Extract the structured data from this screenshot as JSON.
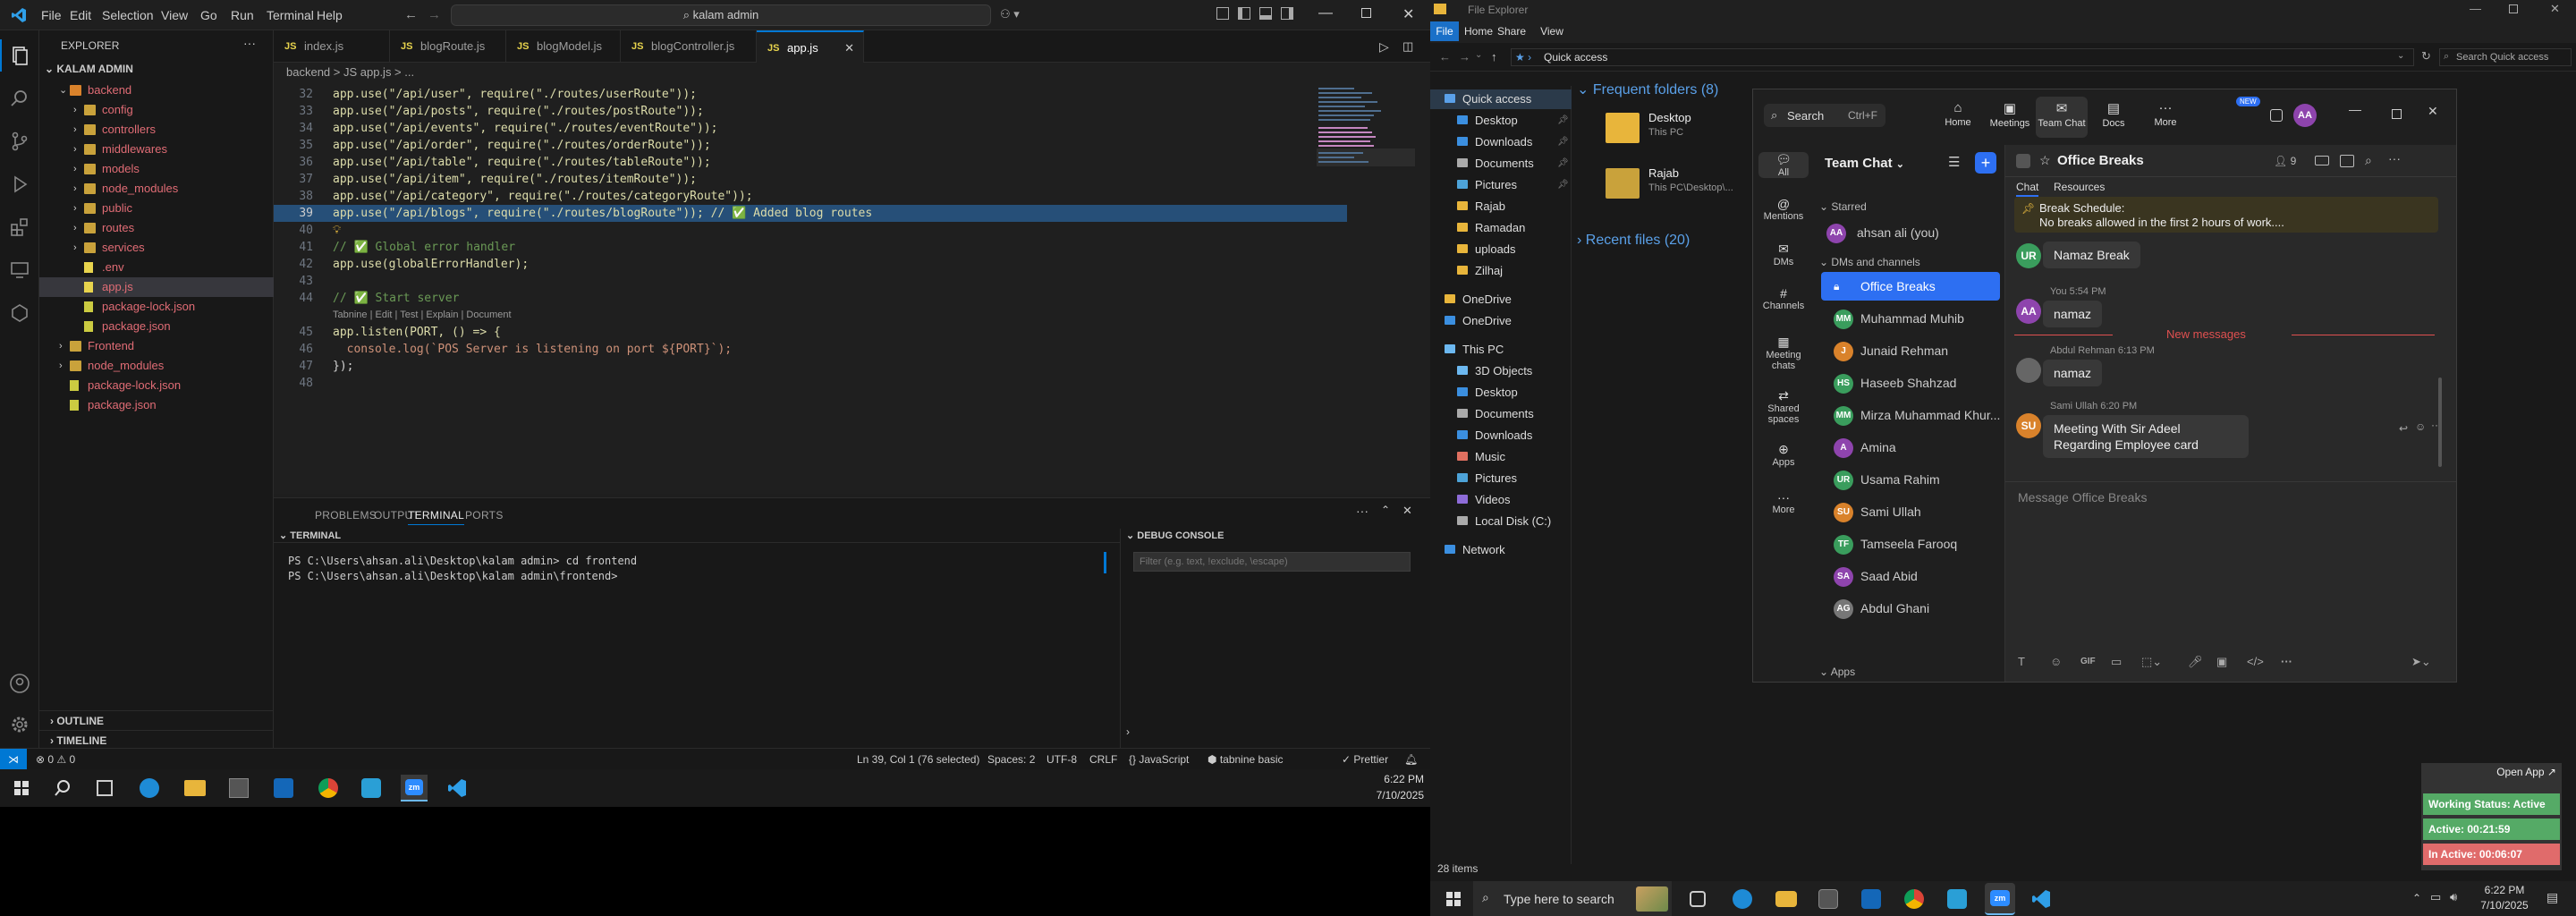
{
  "vscode": {
    "menu": [
      "File",
      "Edit",
      "Selection",
      "View",
      "Go",
      "Run",
      "Terminal",
      "Help"
    ],
    "search_text": "kalam admin",
    "explorer_title": "EXPLORER",
    "root": "KALAM ADMIN",
    "tree": [
      {
        "label": "backend",
        "type": "folder-open",
        "color": "#e06c75"
      },
      {
        "label": "config",
        "type": "folder",
        "color": "#e06c75"
      },
      {
        "label": "controllers",
        "type": "folder",
        "color": "#e06c75"
      },
      {
        "label": "middlewares",
        "type": "folder",
        "color": "#e06c75"
      },
      {
        "label": "models",
        "type": "folder",
        "color": "#e06c75"
      },
      {
        "label": "node_modules",
        "type": "folder",
        "color": "#e06c75"
      },
      {
        "label": "public",
        "type": "folder",
        "color": "#e06c75"
      },
      {
        "label": "routes",
        "type": "folder",
        "color": "#e06c75"
      },
      {
        "label": "services",
        "type": "folder",
        "color": "#e06c75"
      },
      {
        "label": ".env",
        "type": "file",
        "color": "#e06c75"
      },
      {
        "label": "app.js",
        "type": "file",
        "color": "#e06c75"
      },
      {
        "label": "package-lock.json",
        "type": "file",
        "color": "#e06c75"
      },
      {
        "label": "package.json",
        "type": "file",
        "color": "#e06c75"
      },
      {
        "label": "Frontend",
        "type": "folder",
        "color": "#e06c75"
      },
      {
        "label": "node_modules",
        "type": "folder",
        "color": "#e06c75"
      },
      {
        "label": "package-lock.json",
        "type": "file",
        "color": "#e06c75"
      },
      {
        "label": "package.json",
        "type": "file",
        "color": "#e06c75"
      }
    ],
    "outline": "OUTLINE",
    "timeline": "TIMELINE",
    "tabs": [
      "index.js",
      "blogRoute.js",
      "blogModel.js",
      "blogController.js",
      "app.js"
    ],
    "breadcrumb": "backend > JS app.js > ...",
    "code": [
      {
        "n": "32",
        "t": "app.use(\"/api/user\", require(\"./routes/userRoute\"));"
      },
      {
        "n": "33",
        "t": "app.use(\"/api/posts\", require(\"./routes/postRoute\"));"
      },
      {
        "n": "34",
        "t": "app.use(\"/api/events\", require(\"./routes/eventRoute\"));"
      },
      {
        "n": "35",
        "t": "app.use(\"/api/order\", require(\"./routes/orderRoute\"));"
      },
      {
        "n": "36",
        "t": "app.use(\"/api/table\", require(\"./routes/tableRoute\"));"
      },
      {
        "n": "37",
        "t": "app.use(\"/api/item\", require(\"./routes/itemRoute\"));"
      },
      {
        "n": "38",
        "t": "app.use(\"/api/category\", require(\"./routes/categoryRoute\"));"
      },
      {
        "n": "39",
        "t": "app.use(\"/api/blogs\", require(\"./routes/blogRoute\")); // ✅ Added blog routes"
      },
      {
        "n": "40",
        "t": ""
      },
      {
        "n": "41",
        "t": "// ✅ Global error handler"
      },
      {
        "n": "42",
        "t": "app.use(globalErrorHandler);"
      },
      {
        "n": "43",
        "t": ""
      },
      {
        "n": "44",
        "t": "// ✅ Start server"
      },
      {
        "n": "",
        "t": "Tabnine | Edit | Test | Explain | Document"
      },
      {
        "n": "45",
        "t": "app.listen(PORT, () => {"
      },
      {
        "n": "46",
        "t": "  console.log(`POS Server is listening on port ${PORT}`);"
      },
      {
        "n": "47",
        "t": "});"
      },
      {
        "n": "48",
        "t": ""
      }
    ],
    "panel_tabs": [
      "PROBLEMS",
      "OUTPUT",
      "TERMINAL",
      "PORTS"
    ],
    "terminal_title": "TERMINAL",
    "terminal_lines": [
      "PS C:\\Users\\ahsan.ali\\Desktop\\kalam admin> cd frontend",
      "PS C:\\Users\\ahsan.ali\\Desktop\\kalam admin\\frontend> "
    ],
    "debug_title": "DEBUG CONSOLE",
    "debug_filter": "Filter (e.g. text, !exclude, \\escape)",
    "status": {
      "errors": "⊗ 0 ⚠ 0",
      "position": "Ln 39, Col 1 (76 selected)",
      "spaces": "Spaces: 2",
      "encoding": "UTF-8",
      "eol": "CRLF",
      "language": "{} JavaScript",
      "tabnine": "tabnine basic",
      "prettier": "✓ Prettier"
    },
    "taskbar_time": "6:22 PM",
    "taskbar_date": "7/10/2025"
  },
  "explorer": {
    "title": "File Explorer",
    "ribbon_tabs": [
      "File",
      "Home",
      "Share",
      "View"
    ],
    "address": "Quick access",
    "search": "Search Quick access",
    "nav": [
      {
        "label": "Quick access",
        "indent": 0,
        "icon": "star-icon"
      },
      {
        "label": "Desktop",
        "indent": 1,
        "icon": "desktop-icon",
        "pin": true
      },
      {
        "label": "Downloads",
        "indent": 1,
        "icon": "download-icon",
        "pin": true
      },
      {
        "label": "Documents",
        "indent": 1,
        "icon": "documents-icon",
        "pin": true
      },
      {
        "label": "Pictures",
        "indent": 1,
        "icon": "pictures-icon",
        "pin": true
      },
      {
        "label": "Rajab",
        "indent": 1,
        "icon": "folder-icon"
      },
      {
        "label": "Ramadan",
        "indent": 1,
        "icon": "folder-icon"
      },
      {
        "label": "uploads",
        "indent": 1,
        "icon": "folder-icon"
      },
      {
        "label": "Zilhaj",
        "indent": 1,
        "icon": "folder-icon"
      },
      {
        "label": "OneDrive",
        "indent": 0,
        "icon": "folder-icon"
      },
      {
        "label": "OneDrive",
        "indent": 0,
        "icon": "cloud-icon"
      },
      {
        "label": "This PC",
        "indent": 0,
        "icon": "pc-icon"
      },
      {
        "label": "3D Objects",
        "indent": 1,
        "icon": "cube-icon"
      },
      {
        "label": "Desktop",
        "indent": 1,
        "icon": "desktop-icon"
      },
      {
        "label": "Documents",
        "indent": 1,
        "icon": "documents-icon"
      },
      {
        "label": "Downloads",
        "indent": 1,
        "icon": "download-icon"
      },
      {
        "label": "Music",
        "indent": 1,
        "icon": "music-icon"
      },
      {
        "label": "Pictures",
        "indent": 1,
        "icon": "pictures-icon"
      },
      {
        "label": "Videos",
        "indent": 1,
        "icon": "video-icon"
      },
      {
        "label": "Local Disk (C:)",
        "indent": 1,
        "icon": "disk-icon"
      },
      {
        "label": "Network",
        "indent": 0,
        "icon": "network-icon"
      }
    ],
    "frequent_title": "Frequent folders (8)",
    "recent_title": "Recent files (20)",
    "frequent": [
      {
        "name": "Desktop",
        "sub": "This PC"
      },
      {
        "name": "Rajab",
        "sub": "This PC\\Desktop\\..."
      }
    ],
    "item_count": "28 items"
  },
  "teams": {
    "search": "Search",
    "search_hint": "Ctrl+F",
    "top_nav": [
      "Home",
      "Meetings",
      "Team Chat",
      "Docs",
      "More"
    ],
    "new_badge": "NEW",
    "avatar": "AA",
    "rail": [
      "All",
      "Mentions",
      "DMs",
      "Channels",
      "Meeting chats",
      "Shared spaces",
      "Apps",
      "More"
    ],
    "list_title": "Team Chat",
    "starred": "Starred",
    "starred_user": "ahsan ali (you)",
    "dms_label": "DMs and channels",
    "channels": [
      {
        "name": "Office Breaks",
        "initials": "",
        "color": "#2a6fdb",
        "active": true
      },
      {
        "name": "Muhammad Muhib",
        "initials": "MM",
        "color": "#3a9d5d"
      },
      {
        "name": "Junaid Rehman",
        "initials": "J",
        "color": "#d9822b"
      },
      {
        "name": "Haseeb Shahzad",
        "initials": "HS",
        "color": "#3a9d5d"
      },
      {
        "name": "Mirza Muhammad Khur...",
        "initials": "MM",
        "color": "#3a9d5d"
      },
      {
        "name": "Amina",
        "initials": "A",
        "color": "#8e44ad"
      },
      {
        "name": "Usama Rahim",
        "initials": "UR",
        "color": "#3a9d5d"
      },
      {
        "name": "Sami Ullah",
        "initials": "SU",
        "color": "#d9822b"
      },
      {
        "name": "Tamseela Farooq",
        "initials": "TF",
        "color": "#3a9d5d"
      },
      {
        "name": "Saad Abid",
        "initials": "SA",
        "color": "#8e44ad"
      },
      {
        "name": "Abdul Ghani",
        "initials": "AG",
        "color": "#777777"
      }
    ],
    "apps_label": "Apps",
    "chat_title": "Office Breaks",
    "member_count": "9",
    "chat_tabs": [
      "Chat",
      "Resources"
    ],
    "pinned_title": "Break Schedule:",
    "pinned_text": "No breaks allowed in the first 2 hours of work....",
    "messages": [
      {
        "initials": "UR",
        "color": "#3a9d5d",
        "meta": "",
        "text": "Namaz Break"
      },
      {
        "initials": "AA",
        "color": "#8e44ad",
        "meta": "You 5:54 PM",
        "text": "namaz"
      },
      {
        "initials": "",
        "color": "#666",
        "meta": "Abdul Rehman 6:13 PM",
        "text": "namaz"
      },
      {
        "initials": "SU",
        "color": "#d9822b",
        "meta": "Sami Ullah 6:20 PM",
        "text": "Meeting With Sir Adeel Regarding Employee card"
      }
    ],
    "new_messages": "New messages",
    "compose_placeholder": "Message Office Breaks",
    "gif": "GIF"
  },
  "widget": {
    "open_app": "Open App ↗",
    "status": "Working Status: Active",
    "active": "Active: 00:21:59",
    "inactive": "In Active: 00:06:07"
  },
  "taskbar_right": {
    "search": "Type here to search",
    "time": "6:22 PM",
    "date": "7/10/2025"
  }
}
